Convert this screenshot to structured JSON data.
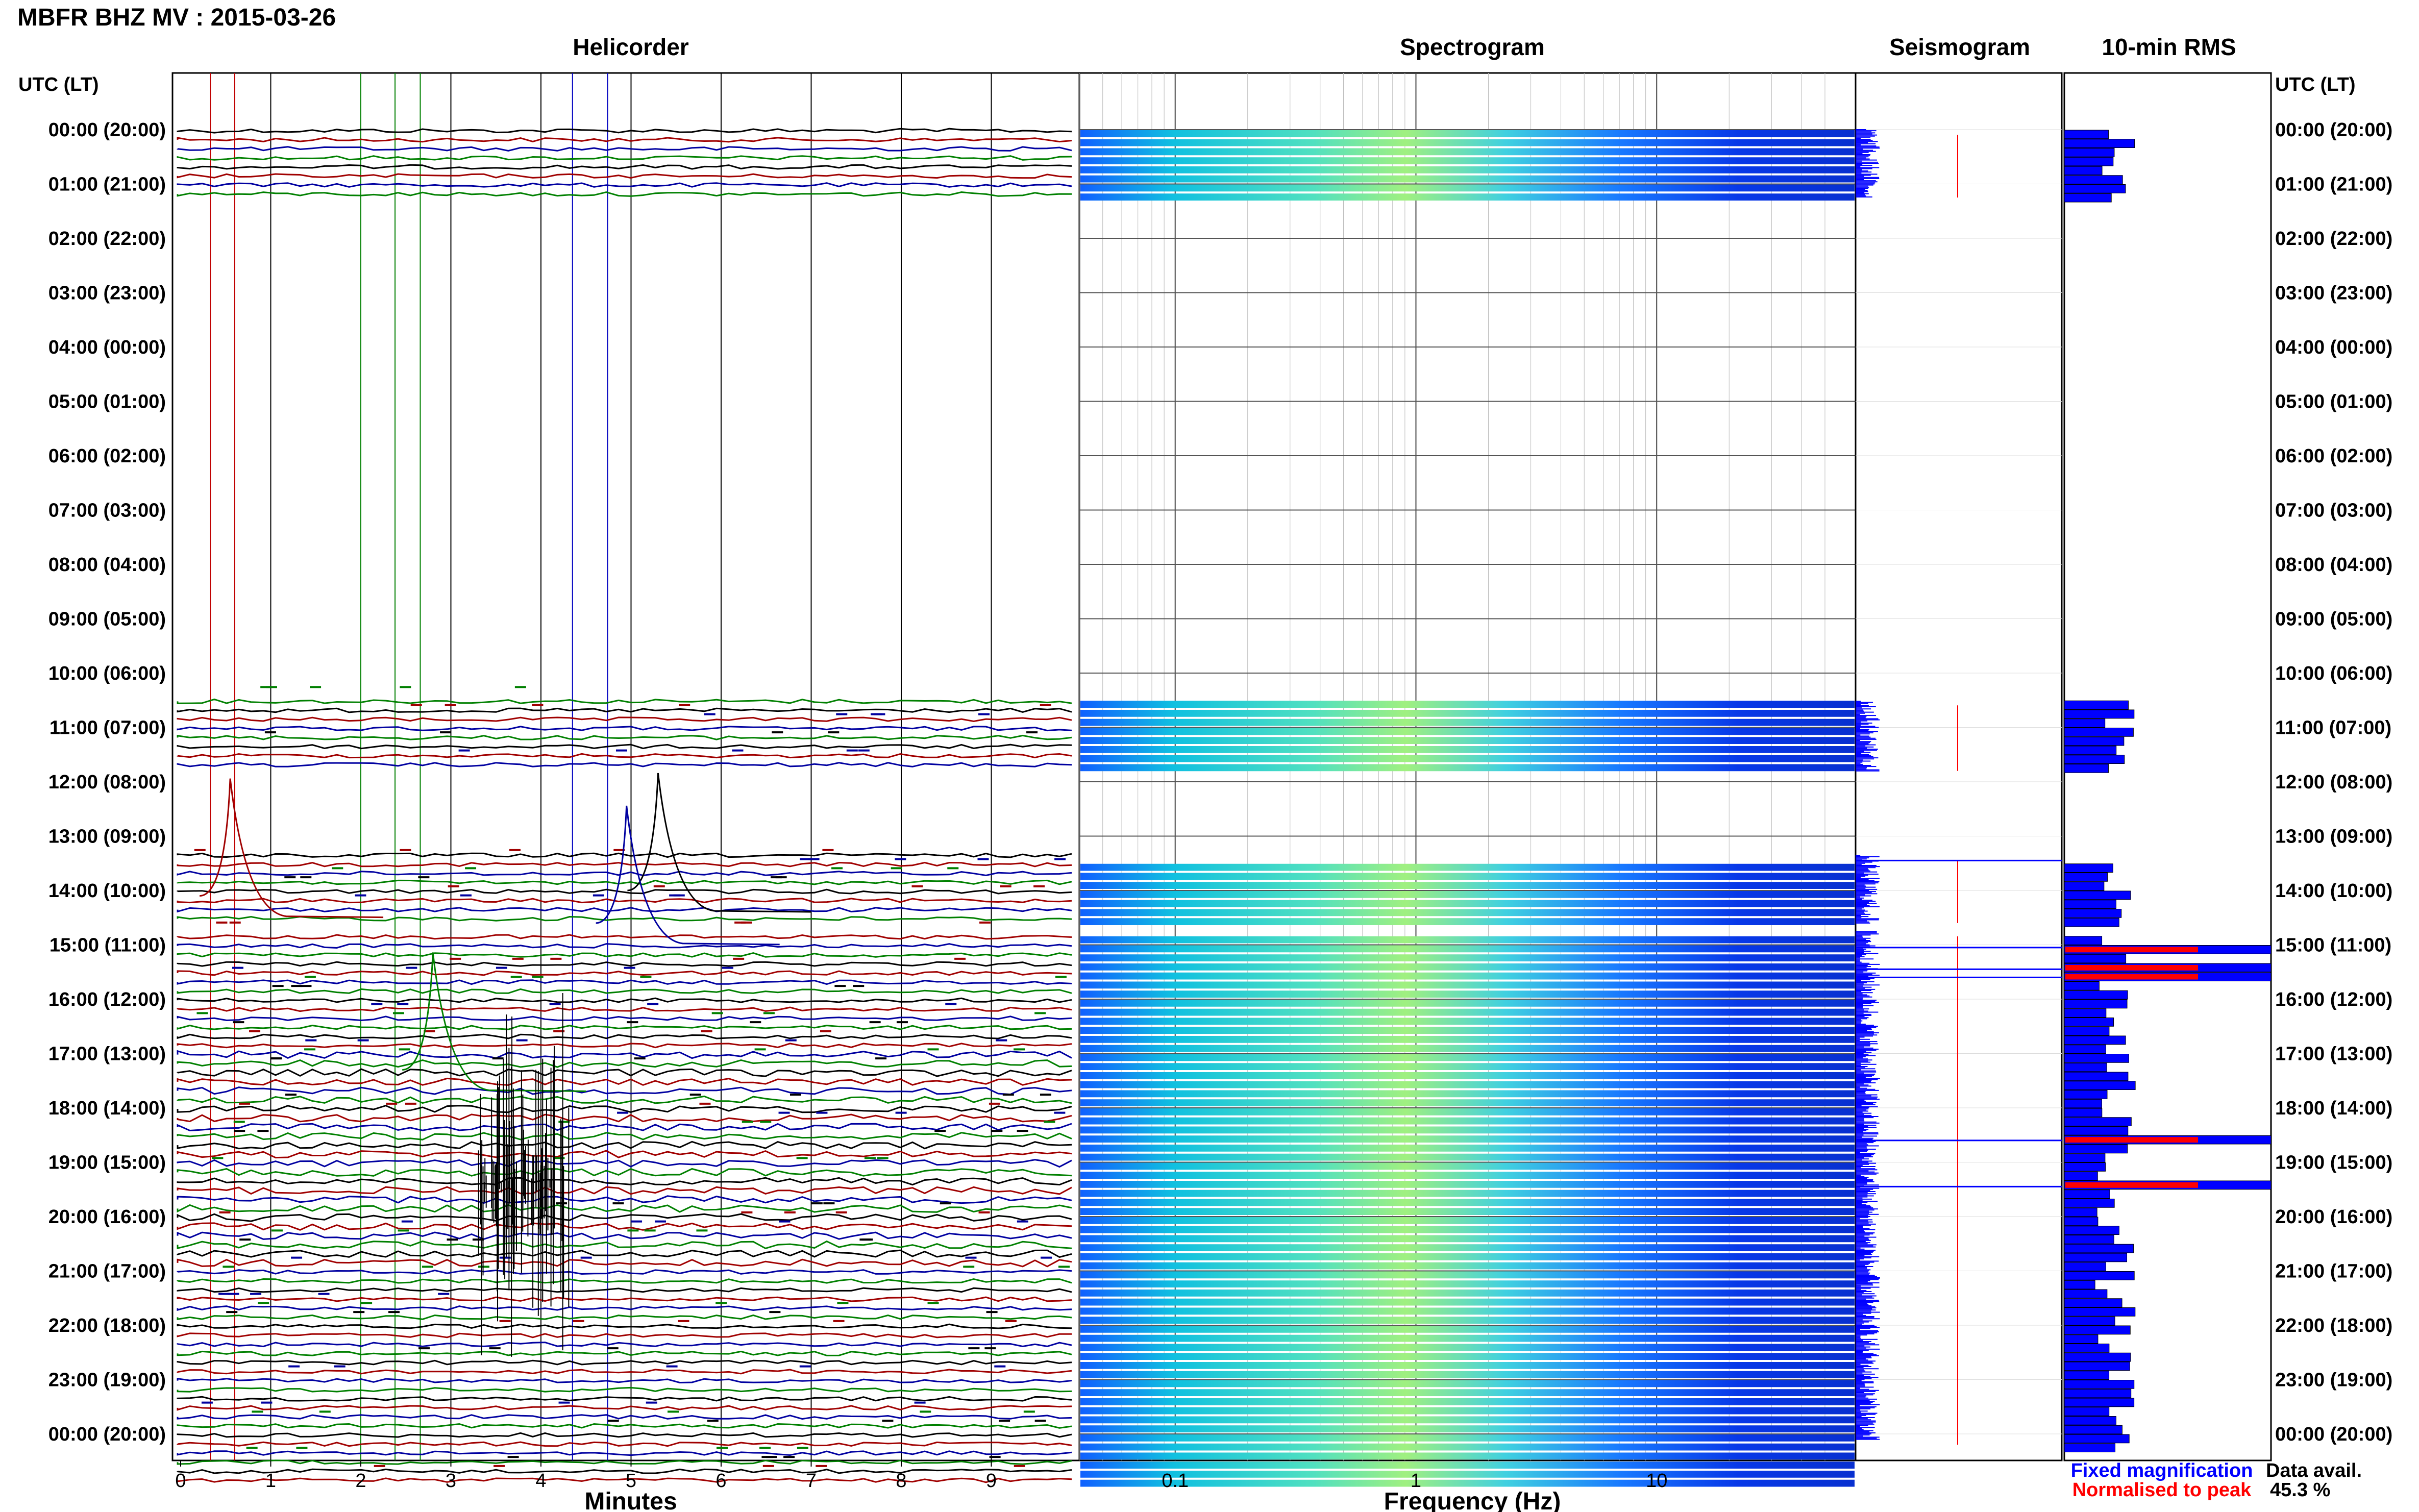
{
  "title": "MBFR BHZ MV : 2015-03-26",
  "panels": {
    "helicorder": "Helicorder",
    "spectrogram": "Spectrogram",
    "seismogram": "Seismogram",
    "rms": "10-min RMS"
  },
  "axis_header_left": "UTC (LT)",
  "axis_header_right": "UTC (LT)",
  "time_labels": [
    "00:00 (20:00)",
    "01:00 (21:00)",
    "02:00 (22:00)",
    "03:00 (23:00)",
    "04:00 (00:00)",
    "05:00 (01:00)",
    "06:00 (02:00)",
    "07:00 (03:00)",
    "08:00 (04:00)",
    "09:00 (05:00)",
    "10:00 (06:00)",
    "11:00 (07:00)",
    "12:00 (08:00)",
    "13:00 (09:00)",
    "14:00 (10:00)",
    "15:00 (11:00)",
    "16:00 (12:00)",
    "17:00 (13:00)",
    "18:00 (14:00)",
    "19:00 (15:00)",
    "20:00 (16:00)",
    "21:00 (17:00)",
    "22:00 (18:00)",
    "23:00 (19:00)",
    "00:00 (20:00)"
  ],
  "helicorder_axis": {
    "label": "Minutes",
    "ticks": [
      "0",
      "1",
      "2",
      "3",
      "4",
      "5",
      "6",
      "7",
      "8",
      "9"
    ]
  },
  "spectrogram_axis": {
    "label": "Frequency (Hz)",
    "ticks": [
      "0.1",
      "1",
      "10"
    ]
  },
  "legend": {
    "fixed": "Fixed magnification",
    "normalised": "Normalised to peak",
    "fixed_color": "#0000ff",
    "normalised_color": "#ff0000"
  },
  "data_avail": {
    "label": "Data avail.",
    "value": "45.3 %"
  },
  "colors": {
    "trace_black": "#000000",
    "trace_red": "#a00000",
    "trace_green": "#008000",
    "trace_blue": "#0000a0",
    "rms_bar": "#0000ff",
    "rms_peak": "#ff0000"
  },
  "chart_data": {
    "type": "heatmap",
    "station": "MBFR BHZ MV",
    "date": "2015-03-26",
    "data_available_percent": 45.3,
    "data_hours_utc": [
      [
        0,
        1.25
      ],
      [
        10.5,
        11.8
      ],
      [
        13.35,
        14.6
      ],
      [
        14.75,
        25
      ]
    ],
    "rms_peak_hours_utc": [
      13.45,
      15.05,
      15.45,
      15.6,
      18.6,
      19.45
    ],
    "helicorder_minutes_range": [
      0,
      10
    ],
    "spectrogram_freq_range_hz": [
      0.04,
      50
    ],
    "spectrogram_log_scale": true
  }
}
